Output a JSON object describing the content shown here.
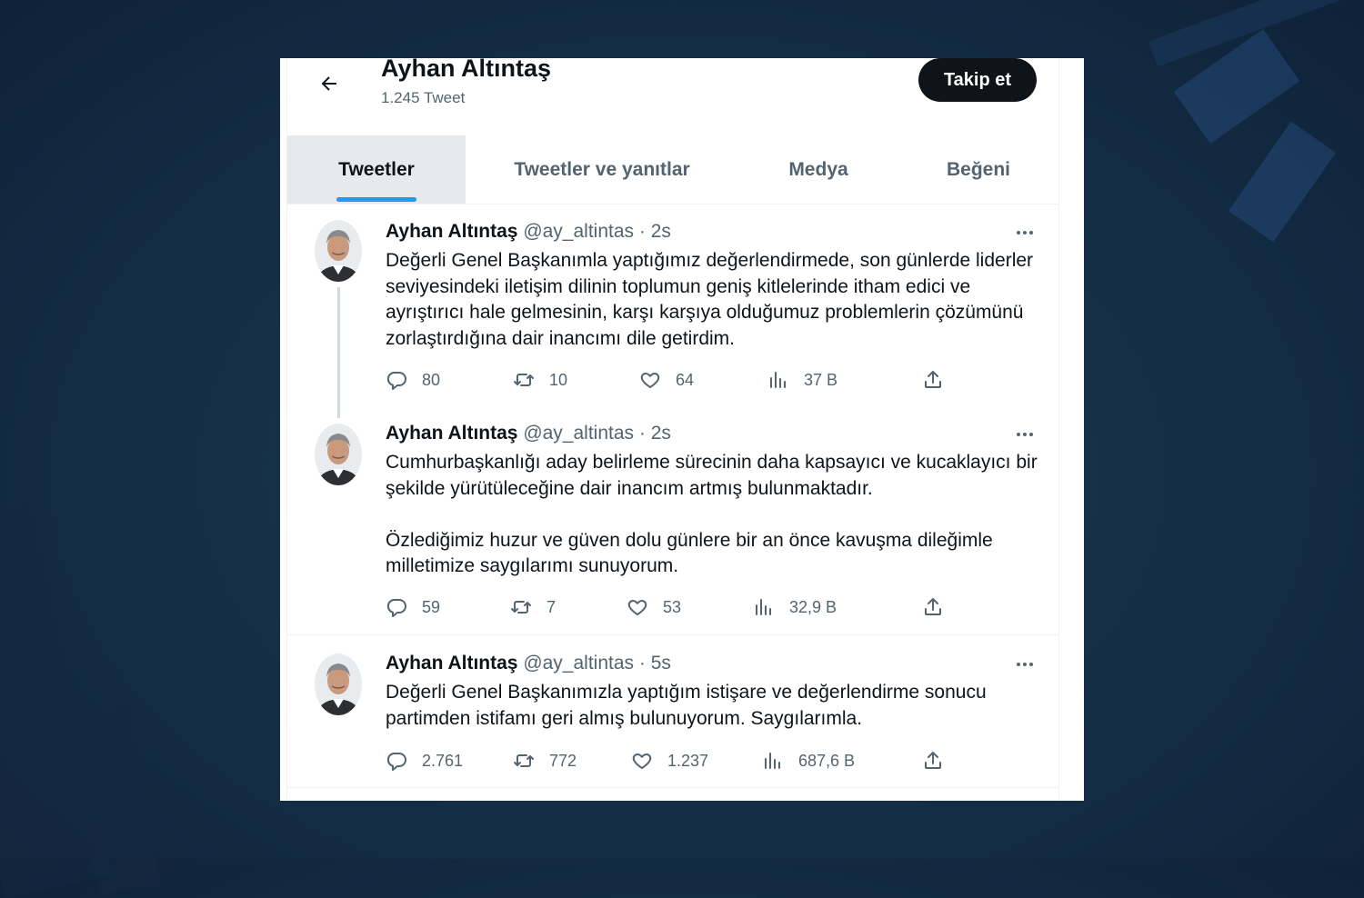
{
  "profile": {
    "name": "Ayhan Altıntaş",
    "tweet_count": "1.245 Tweet",
    "follow_label": "Takip et"
  },
  "tabs": [
    {
      "label": "Tweetler",
      "active": true
    },
    {
      "label": "Tweetler ve yanıtlar",
      "active": false
    },
    {
      "label": "Medya",
      "active": false
    },
    {
      "label": "Beğeni",
      "active": false
    }
  ],
  "tweets": [
    {
      "name": "Ayhan Altıntaş",
      "handle": "@ay_altintas",
      "separator": "·",
      "time": "2s",
      "text": "Değerli Genel Başkanımla yaptığımız değerlendirmede, son günlerde liderler seviyesindeki iletişim dilinin toplumun geniş kitlelerinde itham edici ve ayrıştırıcı hale gelmesinin, karşı karşıya olduğumuz problemlerin çözümünü zorlaştırdığına dair inancımı dile getirdim.",
      "replies": "80",
      "retweets": "10",
      "likes": "64",
      "views": "37 B"
    },
    {
      "name": "Ayhan Altıntaş",
      "handle": "@ay_altintas",
      "separator": "·",
      "time": "2s",
      "text": "Cumhurbaşkanlığı aday belirleme sürecinin daha kapsayıcı ve kucaklayıcı bir şekilde yürütüleceğine dair inancım artmış bulunmaktadır.\n\nÖzlediğimiz huzur ve güven dolu günlere bir an önce kavuşma  dileğimle milletimize saygılarımı sunuyorum.",
      "replies": "59",
      "retweets": "7",
      "likes": "53",
      "views": "32,9 B"
    },
    {
      "name": "Ayhan Altıntaş",
      "handle": "@ay_altintas",
      "separator": "·",
      "time": "5s",
      "text": "Değerli Genel Başkanımızla yaptığım istişare ve değerlendirme sonucu partimden istifamı geri almış bulunuyorum. Saygılarımla.",
      "replies": "2.761",
      "retweets": "772",
      "likes": "1.237",
      "views": "687,6 B"
    }
  ],
  "icons": {
    "back": "arrow-left-icon",
    "more": "more-horizontal-icon",
    "reply": "reply-icon",
    "retweet": "retweet-icon",
    "like": "heart-icon",
    "views": "views-icon",
    "share": "share-icon"
  },
  "colors": {
    "accent": "#1d9bf0",
    "text_primary": "#0f1419",
    "text_secondary": "#536471",
    "follow_bg": "#0f1419"
  }
}
